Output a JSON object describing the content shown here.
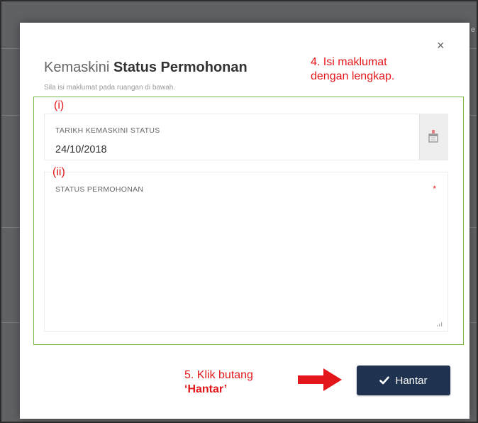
{
  "background": {
    "fragment_text": "e"
  },
  "modal": {
    "close_glyph": "×",
    "title_light": "Kemaskini ",
    "title_bold": "Status Permohonan",
    "subtitle": "Sila isi maklumat pada ruangan di bawah.",
    "fields": {
      "date": {
        "label": "TARIKH KEMASKINI STATUS",
        "value": "24/10/2018",
        "icon": "calendar-icon"
      },
      "status": {
        "label": "STATUS PERMOHONAN",
        "required_mark": "*",
        "value": ""
      }
    },
    "submit": {
      "label": "Hantar",
      "icon": "check-icon"
    }
  },
  "annotations": {
    "step4_line1": "4. Isi maklumat",
    "step4_line2": "dengan lengkap.",
    "marker_i": "(i)",
    "marker_ii": "(ii)",
    "step5_line1": "5. Klik butang",
    "step5_line2": "‘Hantar’"
  },
  "colors": {
    "annotation_red": "#e3171b",
    "highlight_green": "#79b84a",
    "button_navy": "#1f3350"
  }
}
